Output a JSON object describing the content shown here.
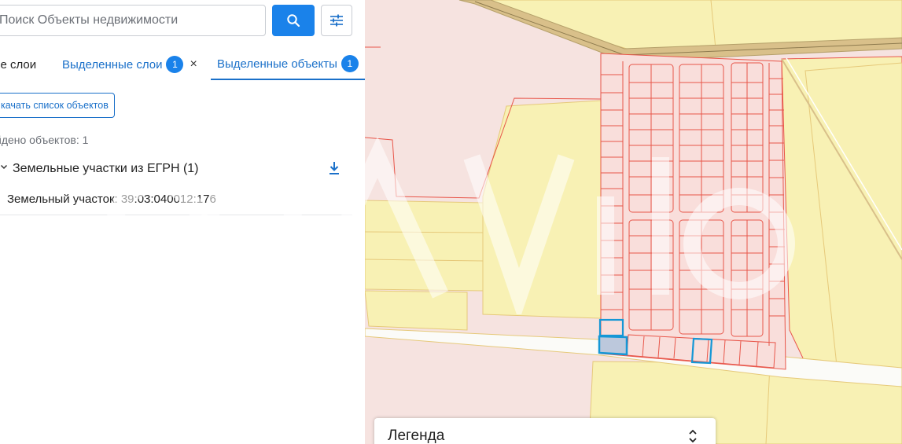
{
  "search": {
    "placeholder": "Поиск Объекты недвижимости"
  },
  "tabs": {
    "all_layers": "се слои",
    "selected_layers": "Выделенные слои",
    "selected_layers_count": "1",
    "selected_objects": "Выделенные объекты",
    "selected_objects_count": "1",
    "close_symbol": "×"
  },
  "results": {
    "download_list_label": "качать список объектов",
    "found_text": "йдено объектов: 1",
    "group_title": "Земельные участки из ЕГРН (1)",
    "object_label": "Земельный участок: 39:03:040012:176"
  },
  "legend": {
    "title": "Легенда"
  },
  "icons": {
    "search": "search-icon",
    "filter": "sliders-icon",
    "chevron": "chevron-down-icon",
    "download": "download-icon",
    "legend_toggle": "expand-collapse-icon"
  },
  "colors": {
    "accent": "#1a82ea",
    "link": "#1a70c9",
    "parcel_fill": "#f9dedb",
    "parcel_stroke": "#e8564a",
    "zone_yellow": "#f8f1b4",
    "selected_parcel": "#1597d6"
  }
}
